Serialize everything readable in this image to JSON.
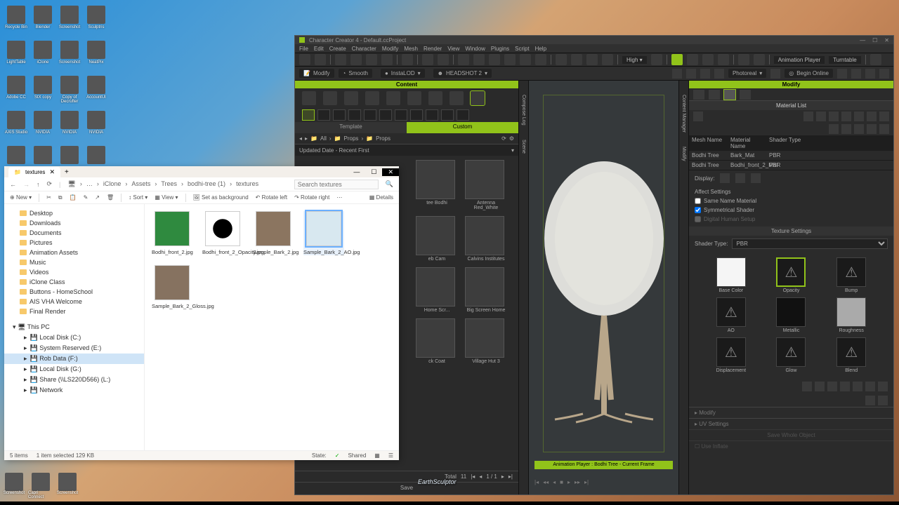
{
  "desktop_icons": [
    "Recycle Bin",
    "Blender",
    "Screenshot",
    "Sculptris",
    "LightTable",
    "iClone",
    "Screenshot",
    "NeatPix",
    "Adobe CC",
    "StX copy",
    "Copy of Decrufter",
    "AccountUI",
    "AXIS Studio",
    "NVIDIA",
    "NVIDIA",
    "NVIDIA",
    "",
    "",
    "",
    ""
  ],
  "taskbar_icons": [
    "Screenshot",
    "Capri Connect",
    "Screenshot"
  ],
  "earth_sculptor": "EarthSculptor",
  "explorer": {
    "tab": "textures",
    "breadcrumb": [
      "iClone",
      "Assets",
      "Trees",
      "bodhi-tree (1)",
      "textures"
    ],
    "search_placeholder": "Search textures",
    "tools": {
      "new": "New",
      "sort": "Sort",
      "view": "View",
      "bg": "Set as background",
      "rotleft": "Rotate left",
      "rotright": "Rotate right",
      "details": "Details"
    },
    "side": {
      "quick": [
        "Desktop",
        "Downloads",
        "Documents",
        "Pictures",
        "Animation Assets",
        "Music",
        "Videos",
        "iClone Class",
        "Buttons - HomeSchool",
        "AIS VHA Welcome",
        "Final Render"
      ],
      "thispc": "This PC",
      "drives": [
        "Local Disk (C:)",
        "System Reserved (E:)",
        "Rob Data (F:)",
        "Local Disk (G:)",
        "Share (\\\\LS220D566) (L:)",
        "Network"
      ]
    },
    "thumbs": [
      {
        "name": "Bodhi_front_2.jpg",
        "sel": false
      },
      {
        "name": "Bodhi_front_2_Opacity.jpg",
        "sel": false
      },
      {
        "name": "Sample_Bark_2.jpg",
        "sel": false
      },
      {
        "name": "Sample_Bark_2_AO.jpg",
        "sel": true
      },
      {
        "name": "Sample_Bark_2_Gloss.jpg",
        "sel": false
      }
    ],
    "status": {
      "count": "5 items",
      "sel": "1 item selected  129 KB",
      "state": "State:",
      "shared": "Shared"
    }
  },
  "cc": {
    "title": "Character Creator 4 - Default.ccProject",
    "menu": [
      "File",
      "Edit",
      "Create",
      "Character",
      "Modify",
      "Mesh",
      "Render",
      "View",
      "Window",
      "Plugins",
      "Script",
      "Help"
    ],
    "tb1": {
      "high": "High",
      "anim": "Animation Player",
      "turntable": "Turntable"
    },
    "tb2": {
      "modify": "Modify",
      "smooth": "Smooth",
      "instalod": "InstaLOD",
      "headshot": "HEADSHOT 2",
      "photoreal": "Photoreal",
      "origin": "Begin Online"
    },
    "content": {
      "title": "Content",
      "tabs": {
        "template": "Template",
        "custom": "Custom"
      },
      "bc": [
        "All",
        "Props",
        "Props"
      ],
      "sort": "Updated Date - Recent First",
      "items": [
        {
          "name": "tee Bodhi"
        },
        {
          "name": "Antenna Red_White"
        },
        {
          "name": "eb Cam"
        },
        {
          "name": "Calvins Institutes"
        },
        {
          "name": "Home Scr..."
        },
        {
          "name": "Big Screen Home"
        },
        {
          "name": "ck Coat"
        },
        {
          "name": "Village Hut 3"
        }
      ],
      "pager": {
        "total": "Total",
        "count": "11",
        "page": "1 / 1"
      },
      "save": "Save"
    },
    "viewport": {
      "anim": "Animation Player : Bodhi Tree - Current Frame"
    },
    "modify": {
      "title": "Modify",
      "matlist": "Material List",
      "cols": {
        "mesh": "Mesh Name",
        "mat": "Material Name",
        "shader": "Shader Type"
      },
      "rows": [
        {
          "mesh": "Bodhi Tree",
          "mat": "Bark_Mat",
          "shader": "PBR"
        },
        {
          "mesh": "Bodhi Tree",
          "mat": "Bodhi_front_2_Mat",
          "shader": "PBR"
        }
      ],
      "display": "Display:",
      "affect": {
        "title": "Affect Settings",
        "same": "Same Name Material",
        "sym": "Symmetrical Shader",
        "dig": "Digital Human Setup"
      },
      "texset": "Texture Settings",
      "shaderlabel": "Shader Type:",
      "shader": "PBR",
      "slots": [
        "Base Color",
        "Opacity",
        "Bump",
        "AO",
        "Metallic",
        "Roughness",
        "Displacement",
        "Glow",
        "Blend"
      ],
      "coll": [
        "Modify",
        "UV Settings",
        "Save Whole Object",
        "Use Inflate"
      ]
    },
    "side_tabs_left": [
      "Compose Log",
      "Scene"
    ],
    "side_tabs_right": [
      "Content Manager",
      "Modify"
    ]
  }
}
